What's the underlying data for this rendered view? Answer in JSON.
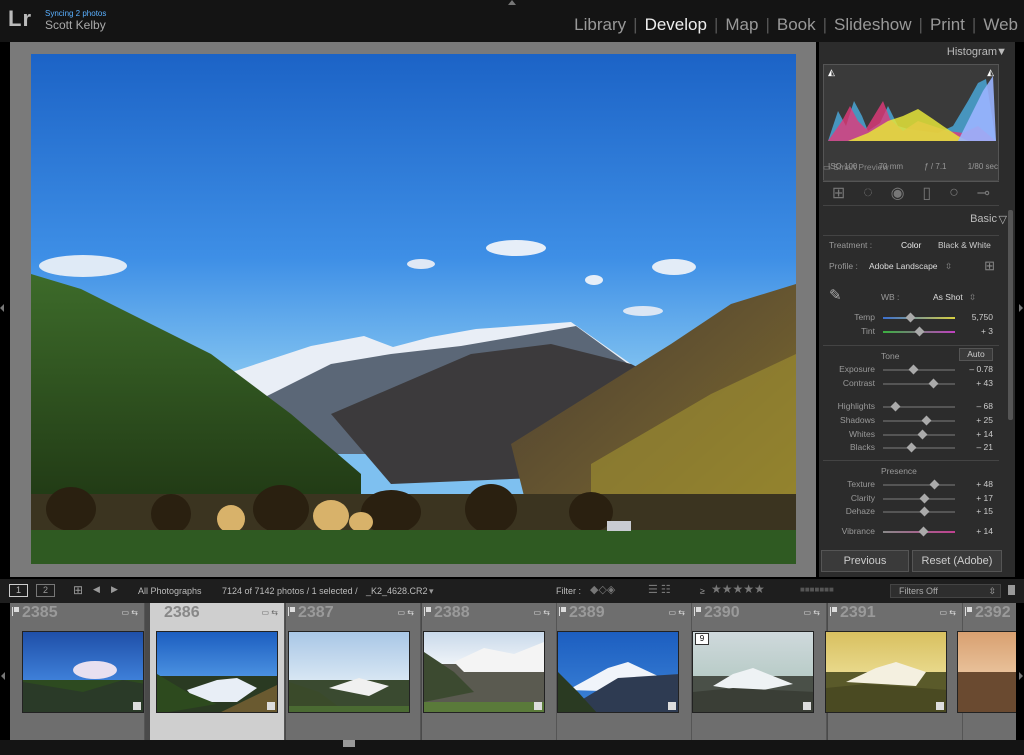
{
  "app": {
    "logo": "Lr",
    "sync_status": "Syncing 2 photos",
    "user": "Scott Kelby"
  },
  "modules": [
    "Library",
    "Develop",
    "Map",
    "Book",
    "Slideshow",
    "Print",
    "Web"
  ],
  "active_module": "Develop",
  "histogram": {
    "title": "Histogram",
    "exif": {
      "iso": "ISO 100",
      "focal": "70 mm",
      "aperture": "ƒ / 7.1",
      "shutter": "1/80 sec"
    },
    "smart_preview": "Smart Preview"
  },
  "basic": {
    "title": "Basic",
    "treatment_label": "Treatment :",
    "treatment_color": "Color",
    "treatment_bw": "Black & White",
    "profile_label": "Profile :",
    "profile_value": "Adobe Landscape",
    "wb_label": "WB :",
    "wb_value": "As Shot",
    "temp": {
      "label": "Temp",
      "value": "5,750",
      "pos": 0.38
    },
    "tint": {
      "label": "Tint",
      "value": "+ 3",
      "pos": 0.5
    },
    "tone_label": "Tone",
    "auto_label": "Auto",
    "exposure": {
      "label": "Exposure",
      "value": "– 0.78",
      "pos": 0.42
    },
    "contrast": {
      "label": "Contrast",
      "value": "+ 43",
      "pos": 0.7
    },
    "highlights": {
      "label": "Highlights",
      "value": "– 68",
      "pos": 0.18
    },
    "shadows": {
      "label": "Shadows",
      "value": "+ 25",
      "pos": 0.6
    },
    "whites": {
      "label": "Whites",
      "value": "+ 14",
      "pos": 0.55
    },
    "blacks": {
      "label": "Blacks",
      "value": "– 21",
      "pos": 0.4
    },
    "presence_label": "Presence",
    "texture": {
      "label": "Texture",
      "value": "+ 48",
      "pos": 0.72
    },
    "clarity": {
      "label": "Clarity",
      "value": "+ 17",
      "pos": 0.58
    },
    "dehaze": {
      "label": "Dehaze",
      "value": "+ 15",
      "pos": 0.57
    },
    "vibrance": {
      "label": "Vibrance",
      "value": "+ 14",
      "pos": 0.56
    }
  },
  "buttons": {
    "previous": "Previous",
    "reset": "Reset (Adobe)"
  },
  "filmstrip_bar": {
    "page1": "1",
    "page2": "2",
    "source": "All Photographs",
    "count": "7124 of 7142 photos / 1 selected /",
    "filename": "_K2_4628.CR2",
    "filter_label": "Filter :",
    "rating_op": "≥",
    "filters_off": "Filters Off"
  },
  "filmstrip": [
    {
      "num": "2385"
    },
    {
      "num": "2386",
      "selected": true
    },
    {
      "num": "2387"
    },
    {
      "num": "2388"
    },
    {
      "num": "2389"
    },
    {
      "num": "2390",
      "badge": "9"
    },
    {
      "num": "2391"
    },
    {
      "num": "2392"
    }
  ]
}
